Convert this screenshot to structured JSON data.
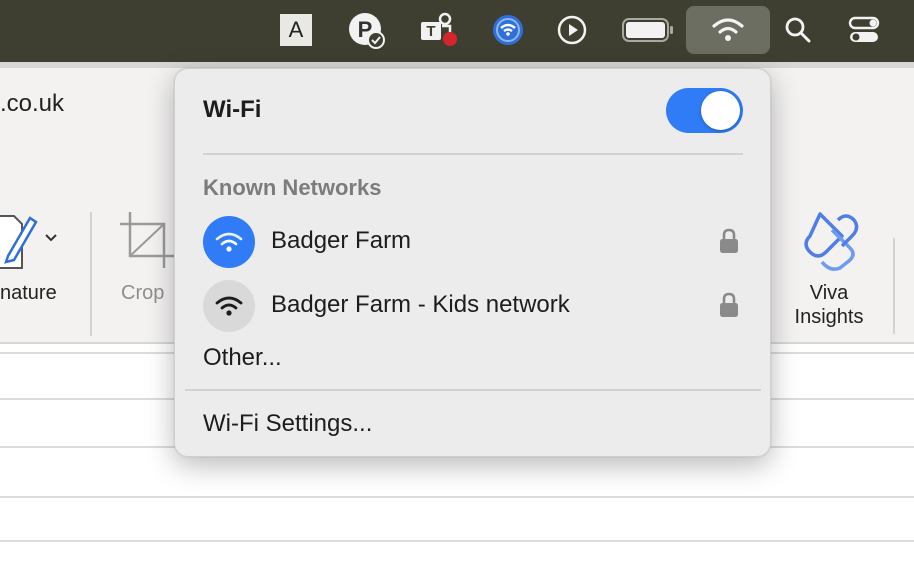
{
  "menubar": {
    "items": [
      {
        "name": "input-source-icon",
        "label": "A"
      },
      {
        "name": "password-app-icon"
      },
      {
        "name": "teams-icon"
      },
      {
        "name": "vpn-icon"
      },
      {
        "name": "play-icon"
      },
      {
        "name": "battery-icon"
      },
      {
        "name": "wifi-icon"
      },
      {
        "name": "spotlight-search-icon"
      },
      {
        "name": "control-center-icon"
      }
    ]
  },
  "app": {
    "domain_text": ".co.uk",
    "ribbon": {
      "signature_label": "nature",
      "crop_label": "Crop",
      "viva_label_line1": "Viva",
      "viva_label_line2": "Insights"
    }
  },
  "wifi_menu": {
    "title": "Wi-Fi",
    "toggle_on": true,
    "known_networks_heading": "Known Networks",
    "networks": [
      {
        "name": "Badger Farm",
        "connected": true,
        "locked": true
      },
      {
        "name": "Badger Farm - Kids network",
        "connected": false,
        "locked": true
      }
    ],
    "other_label": "Other...",
    "settings_label": "Wi-Fi Settings..."
  },
  "colors": {
    "accent": "#2f7cf6",
    "menubar": "#3e3f31",
    "viva": "#4f7fe6"
  }
}
